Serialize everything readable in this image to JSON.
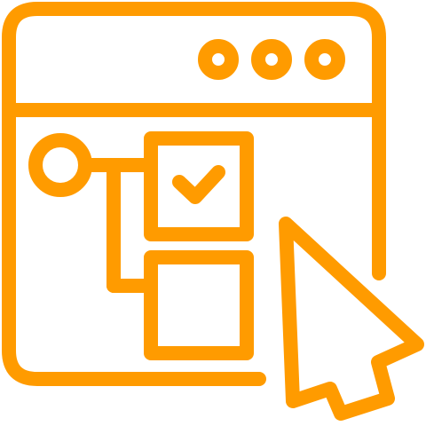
{
  "icon": {
    "name": "browser-window-checklist-cursor-icon",
    "stroke_color": "#FF9B00",
    "background": "#FFFFFF"
  },
  "checklist": {
    "items": [
      {
        "checked": true
      },
      {
        "checked": false
      }
    ]
  },
  "window_controls": {
    "dot_count": 3
  }
}
